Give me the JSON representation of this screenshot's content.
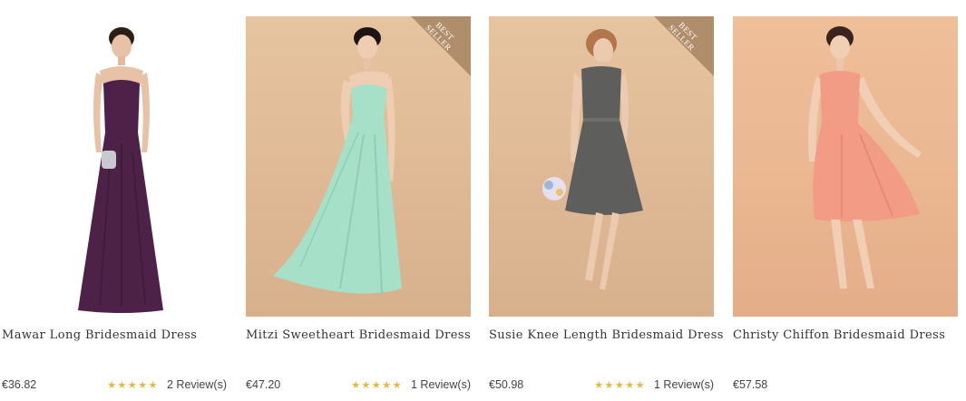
{
  "products": [
    {
      "name": "Mawar Long Bridesmaid Dress",
      "price": "€36.82",
      "stars": "★★★★★",
      "reviews": "2 Review(s)",
      "badge": "",
      "dress_color": "#4e2148",
      "background": "white"
    },
    {
      "name": "Mitzi Sweetheart Bridesmaid Dress",
      "price": "€47.20",
      "stars": "★★★★★",
      "reviews": "1 Review(s)",
      "badge": "BEST SELLER",
      "dress_color": "#a6e0c8",
      "background": "tan"
    },
    {
      "name": "Susie Knee Length Bridesmaid Dress",
      "price": "€50.98",
      "stars": "★★★★★",
      "reviews": "1 Review(s)",
      "badge": "BEST SELLER",
      "dress_color": "#5e5e5c",
      "background": "tan"
    },
    {
      "name": "Christy Chiffon Bridesmaid Dress",
      "price": "€57.58",
      "stars": "",
      "reviews": "",
      "badge": "",
      "dress_color": "#f29c86",
      "background": "peach"
    }
  ],
  "colors": {
    "star": "#e5b83a",
    "badge": "#b08e6b"
  }
}
